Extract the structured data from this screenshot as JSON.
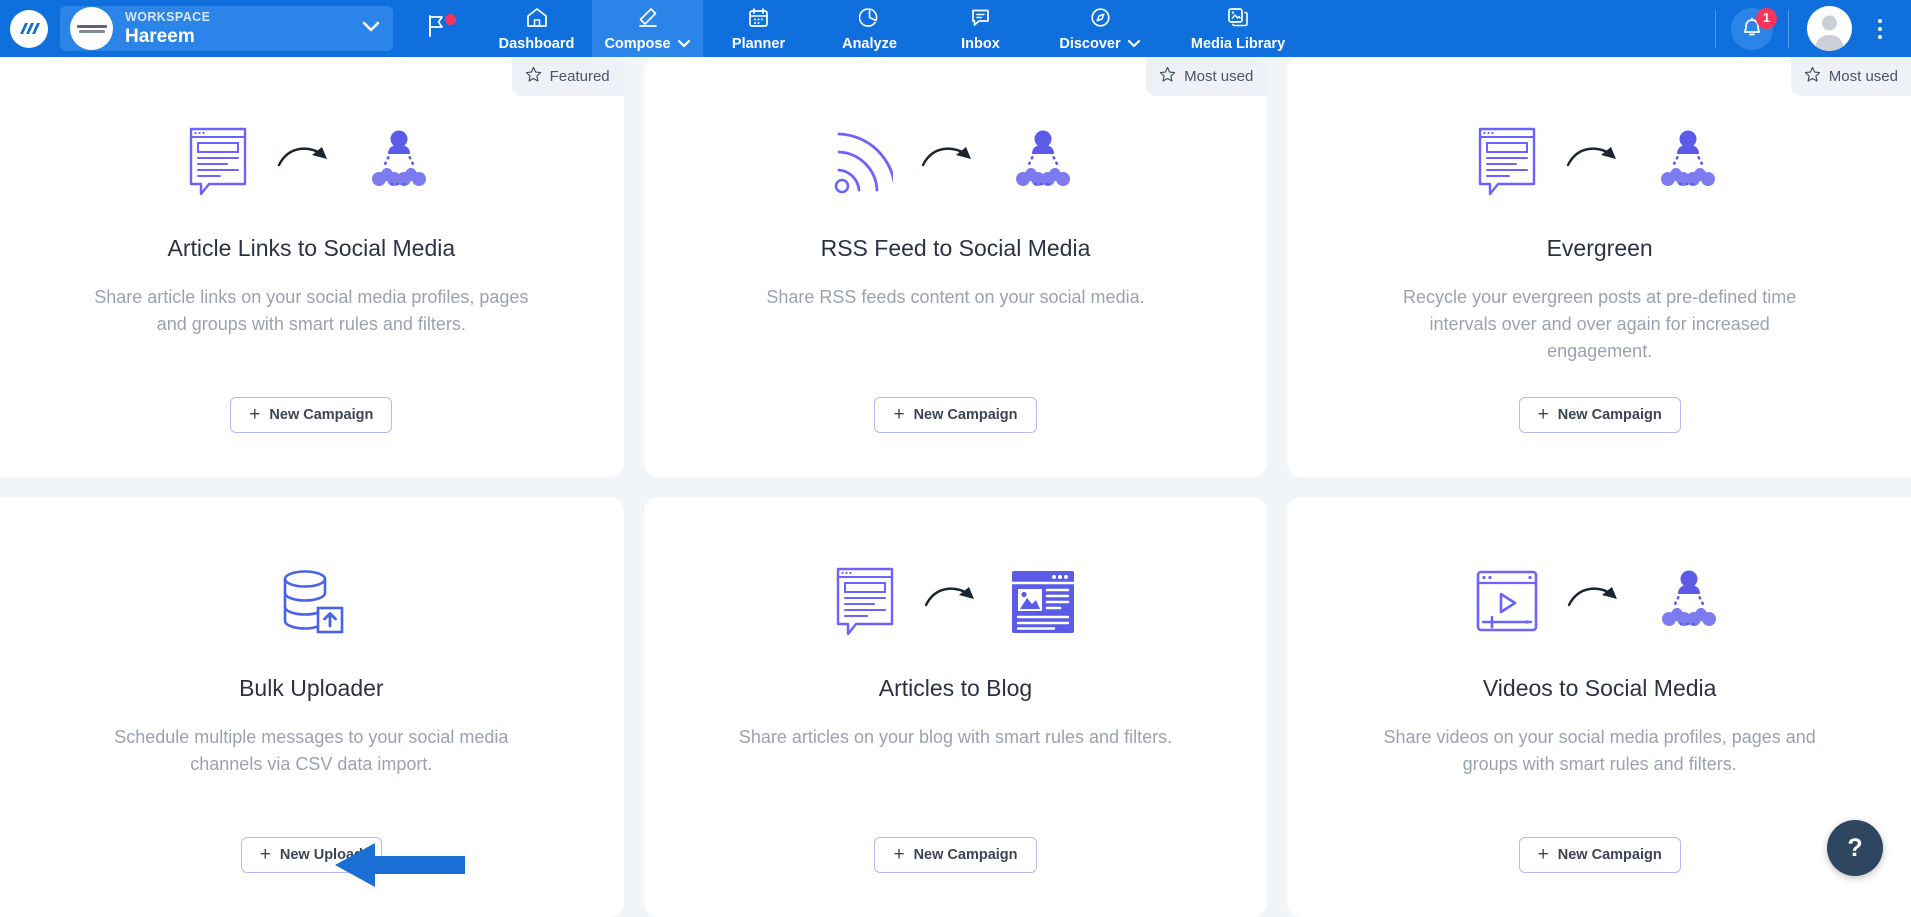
{
  "topbar": {
    "logo_icon": "contentstudio-logo-icon",
    "workspace": {
      "label": "WORKSPACE",
      "name": "Hareem",
      "chevron_icon": "chevron-down-icon",
      "avatar_icon": "workspace-avatar"
    },
    "flag_icon": "flag-icon",
    "nav_items": [
      {
        "label": "Dashboard",
        "icon": "home-icon",
        "active": false,
        "has_chevron": false
      },
      {
        "label": "Compose",
        "icon": "pencil-icon",
        "active": true,
        "has_chevron": true
      },
      {
        "label": "Planner",
        "icon": "calendar-icon",
        "active": false,
        "has_chevron": false
      },
      {
        "label": "Analyze",
        "icon": "pie-chart-icon",
        "active": false,
        "has_chevron": false
      },
      {
        "label": "Inbox",
        "icon": "chat-bubble-icon",
        "active": false,
        "has_chevron": false
      },
      {
        "label": "Discover",
        "icon": "compass-icon",
        "active": false,
        "has_chevron": true
      },
      {
        "label": "Media Library",
        "icon": "image-stack-icon",
        "active": false,
        "has_chevron": false
      }
    ],
    "notifications": {
      "icon": "bell-icon",
      "count": "1"
    },
    "profile_icon": "user-avatar-icon",
    "menu_icon": "kebab-menu-icon"
  },
  "cards": [
    {
      "id": "article-links-to-social-media",
      "badge": "Featured",
      "badge_icon": "star-outline-icon",
      "title": "Article Links to Social Media",
      "description": "Share article links on your social media profiles, pages and groups with smart rules and filters.",
      "button": "New Campaign",
      "icon_left": "article-document-icon",
      "icon_mid": "curved-arrow-icon",
      "icon_right": "social-network-icon"
    },
    {
      "id": "rss-feed-to-social-media",
      "badge": "Most used",
      "badge_icon": "star-outline-icon",
      "title": "RSS Feed to Social Media",
      "description": "Share RSS feeds content on your social media.",
      "button": "New Campaign",
      "icon_left": "rss-feed-icon",
      "icon_mid": "curved-arrow-icon",
      "icon_right": "social-network-icon"
    },
    {
      "id": "evergreen",
      "badge": "Most used",
      "badge_icon": "star-outline-icon",
      "title": "Evergreen",
      "description": "Recycle your evergreen posts at pre-defined time intervals over and over again for increased engagement.",
      "button": "New Campaign",
      "icon_left": "article-document-icon",
      "icon_mid": "curved-arrow-icon",
      "icon_right": "social-network-icon"
    },
    {
      "id": "bulk-uploader",
      "badge": "",
      "badge_icon": "",
      "title": "Bulk Uploader",
      "description": "Schedule multiple messages to your social media channels via CSV data import.",
      "button": "New Upload",
      "icon_left": "database-upload-icon",
      "icon_mid": "",
      "icon_right": ""
    },
    {
      "id": "articles-to-blog",
      "badge": "",
      "badge_icon": "",
      "title": "Articles to Blog",
      "description": "Share articles on your blog with smart rules and filters.",
      "button": "New Campaign",
      "icon_left": "article-document-icon",
      "icon_mid": "curved-arrow-icon",
      "icon_right": "blog-page-icon"
    },
    {
      "id": "videos-to-social-media",
      "badge": "",
      "badge_icon": "",
      "title": "Videos to Social Media",
      "description": "Share videos on your social media profiles, pages and groups with smart rules and filters.",
      "button": "New Campaign",
      "icon_left": "video-player-icon",
      "icon_mid": "curved-arrow-icon",
      "icon_right": "social-network-icon"
    }
  ],
  "annotation": {
    "arrow_icon": "left-pointing-arrow",
    "color": "#1a6fd4"
  },
  "help": {
    "label": "?",
    "icon": "question-mark-icon"
  },
  "colors": {
    "nav_blue": "#0f6fdd",
    "nav_active_blue": "#2b84e8",
    "page_bg": "#f2f5f8",
    "accent_purple": "#6c63ff",
    "badge_red": "#f5365c",
    "help_navy": "#2f4661"
  }
}
